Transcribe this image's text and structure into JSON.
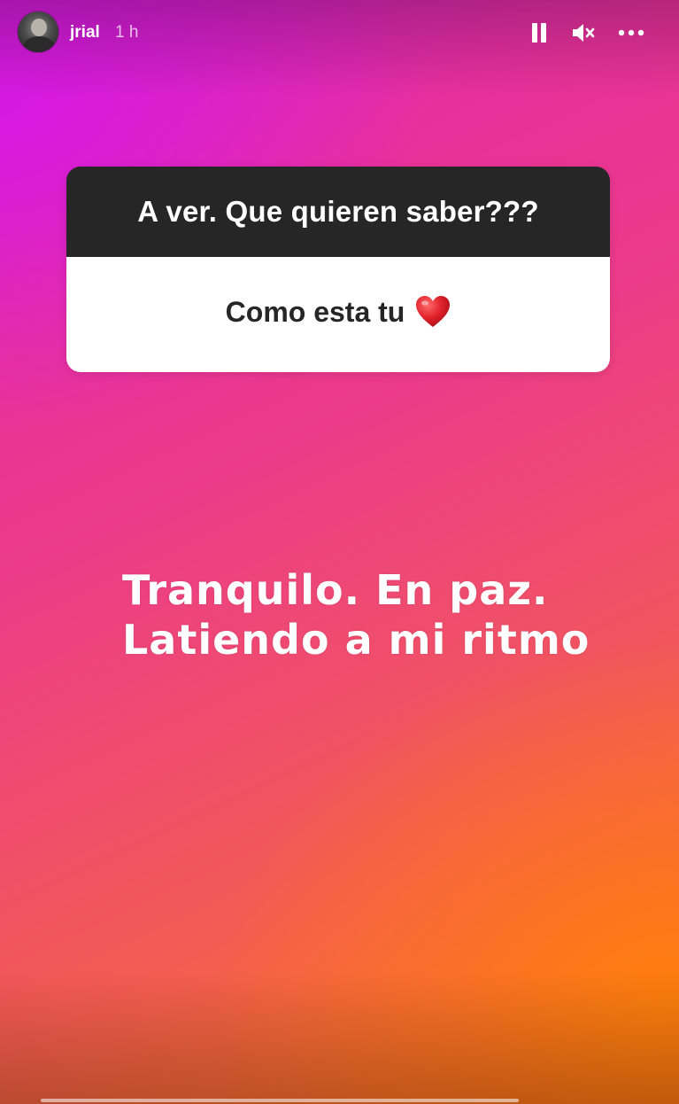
{
  "header": {
    "username": "jrial",
    "timestamp": "1 h",
    "avatar_icon": "profile-photo",
    "controls": [
      {
        "name": "pause",
        "icon": "pause-icon"
      },
      {
        "name": "mute",
        "icon": "speaker-muted-icon"
      },
      {
        "name": "more",
        "icon": "more-dots-icon"
      }
    ]
  },
  "sticker": {
    "question": "A ver. Que quieren saber???",
    "answer": "Como esta tu",
    "answer_icon": "red-heart-icon",
    "question_bg": "#262626",
    "answer_bg": "#ffffff"
  },
  "caption": {
    "line1": "Tranquilo. En paz.",
    "line2": "Latiendo a mi ritmo"
  },
  "colors": {
    "gradient_start": "#d41fcf",
    "gradient_mid": "#ef4a72",
    "gradient_end": "#f8781c",
    "heart": "#e0202a"
  }
}
